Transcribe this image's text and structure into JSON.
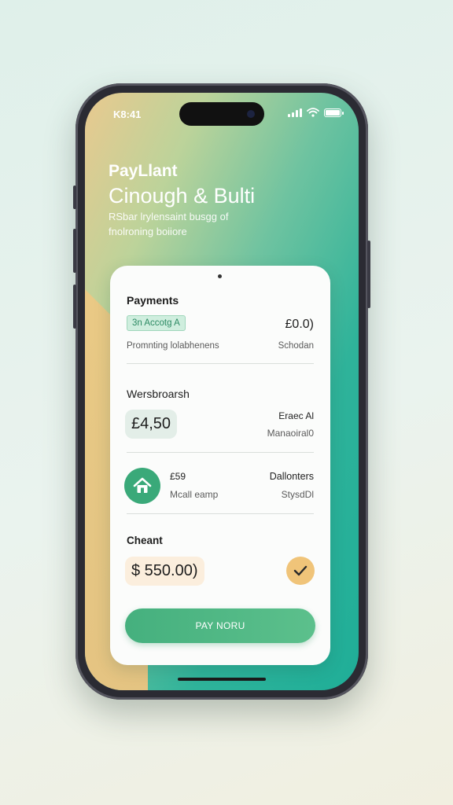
{
  "status_bar": {
    "time": "K8:41",
    "icons": [
      "signal-icon",
      "wifi-icon",
      "battery-icon"
    ]
  },
  "header": {
    "app_name": "PayLlant",
    "headline": "Cinough & Bulti",
    "subtext": "RSbar lrylensaint busgg of fnolroning boiiore"
  },
  "card": {
    "payments": {
      "title": "Payments",
      "tag": "3n Accotg A",
      "amount": "£0.0)",
      "description": "Promnting lolabhenens",
      "status": "Schodan"
    },
    "section2": {
      "title": "Wersbroarsh",
      "amount": "£4,50",
      "right_label": "Eraec Al",
      "right_sub": "Manaoiral0"
    },
    "section3": {
      "amount": "£59",
      "label": "Mcall eamp",
      "right_label": "Dallonters",
      "right_sub": "StysdDl",
      "icon": "home-icon"
    },
    "section4": {
      "title": "Cheant",
      "amount": "$ 550.00)",
      "icon": "check-icon"
    },
    "pay_button": "PAY NORU"
  },
  "colors": {
    "accent_green": "#3aa979",
    "accent_peach": "#f0c479",
    "gradient_teal": "#1fae98",
    "gradient_sand": "#e9c98f"
  }
}
